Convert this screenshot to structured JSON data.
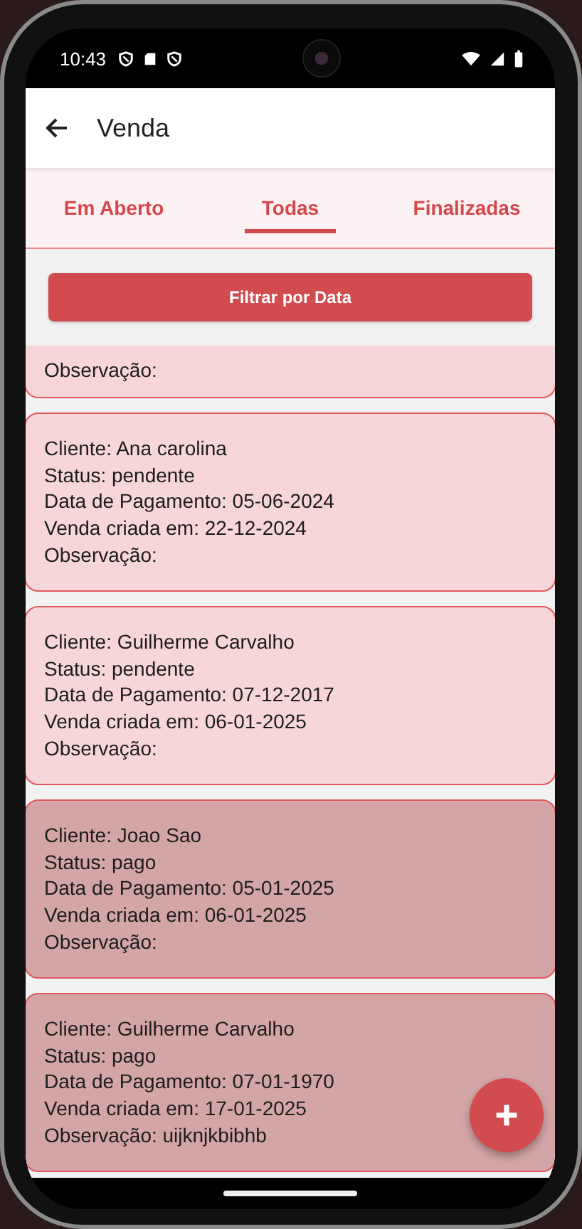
{
  "status_bar": {
    "time": "10:43"
  },
  "app_bar": {
    "title": "Venda"
  },
  "tabs": [
    {
      "label": "Em Aberto",
      "selected": false
    },
    {
      "label": "Todas",
      "selected": true
    },
    {
      "label": "Finalizadas",
      "selected": false
    }
  ],
  "filter_button": "Filtrar por Data",
  "sales": [
    {
      "clipped_top": true,
      "paid": false,
      "lines": [
        "Observação:"
      ]
    },
    {
      "clipped_top": false,
      "paid": false,
      "lines": [
        "Cliente: Ana carolina",
        "Status: pendente",
        "Data de Pagamento: 05-06-2024",
        "Venda criada em: 22-12-2024",
        "Observação:"
      ]
    },
    {
      "clipped_top": false,
      "paid": false,
      "lines": [
        "Cliente: Guilherme Carvalho",
        "Status: pendente",
        "Data de Pagamento: 07-12-2017",
        "Venda criada em: 06-01-2025",
        "Observação:"
      ]
    },
    {
      "clipped_top": false,
      "paid": true,
      "lines": [
        "Cliente: Joao Sao",
        "Status: pago",
        "Data de Pagamento: 05-01-2025",
        "Venda criada em: 06-01-2025",
        "Observação:"
      ]
    },
    {
      "clipped_top": false,
      "paid": true,
      "lines": [
        "Cliente: Guilherme Carvalho",
        "Status: pago",
        "Data de Pagamento: 07-01-1970",
        "Venda criada em: 17-01-2025",
        "Observação: uijknjkbibhb"
      ]
    }
  ]
}
